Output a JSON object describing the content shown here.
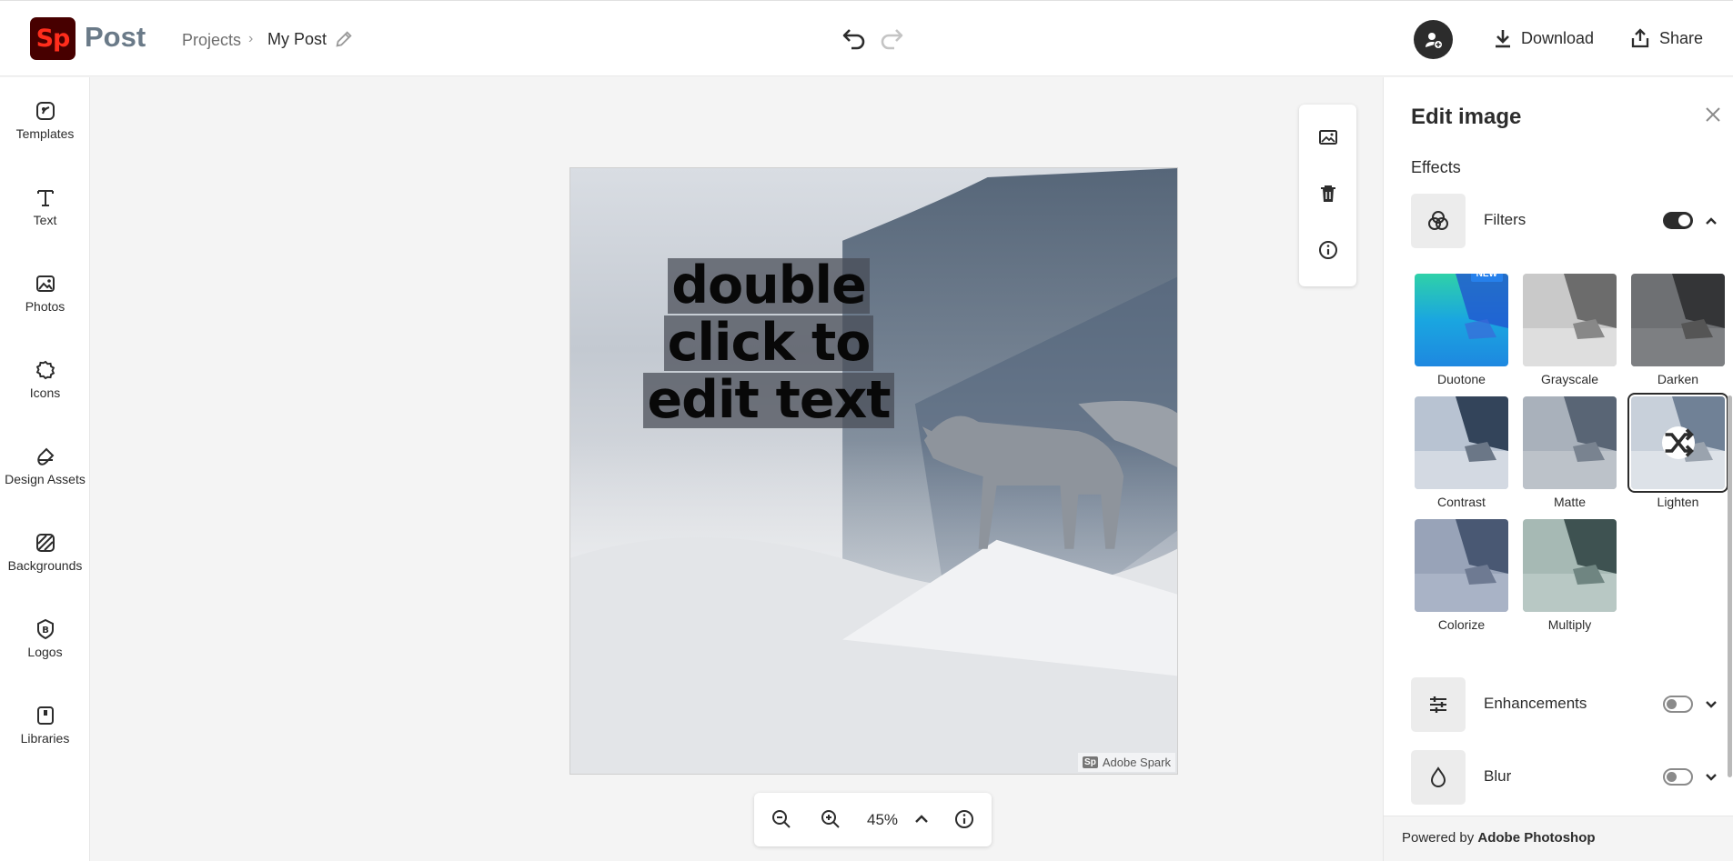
{
  "header": {
    "logo_text": "Sp",
    "app_name": "Post",
    "breadcrumb_projects": "Projects",
    "breadcrumb_separator": "›",
    "document_title": "My Post",
    "download_label": "Download",
    "share_label": "Share"
  },
  "sidebar": {
    "items": [
      {
        "label": "Templates",
        "icon": "templates-icon"
      },
      {
        "label": "Text",
        "icon": "text-icon"
      },
      {
        "label": "Photos",
        "icon": "photos-icon"
      },
      {
        "label": "Icons",
        "icon": "icons-icon"
      },
      {
        "label": "Design Assets",
        "icon": "design-assets-icon"
      },
      {
        "label": "Backgrounds",
        "icon": "backgrounds-icon"
      },
      {
        "label": "Logos",
        "icon": "logos-icon"
      },
      {
        "label": "Libraries",
        "icon": "libraries-icon"
      }
    ]
  },
  "canvas": {
    "text_lines": [
      "double",
      "click to",
      "edit text"
    ],
    "watermark_logo": "Sp",
    "watermark_text": "Adobe Spark"
  },
  "zoom": {
    "level": "45%"
  },
  "panel": {
    "title": "Edit image",
    "section_label": "Effects",
    "filters": {
      "label": "Filters",
      "enabled": true,
      "expanded": true,
      "items": [
        {
          "label": "Duotone",
          "badge": "NEW"
        },
        {
          "label": "Grayscale"
        },
        {
          "label": "Darken"
        },
        {
          "label": "Contrast"
        },
        {
          "label": "Matte"
        },
        {
          "label": "Lighten",
          "selected": true
        },
        {
          "label": "Colorize"
        },
        {
          "label": "Multiply"
        }
      ]
    },
    "enhancements": {
      "label": "Enhancements",
      "enabled": false
    },
    "blur": {
      "label": "Blur",
      "enabled": false
    },
    "powered_prefix": "Powered by",
    "powered_brand": "Adobe Photoshop"
  },
  "colors": {
    "logo_bg": "#470000",
    "logo_fg": "#ff2d1c",
    "accent_badge": "#2680eb",
    "ink": "#2c2c2c"
  }
}
